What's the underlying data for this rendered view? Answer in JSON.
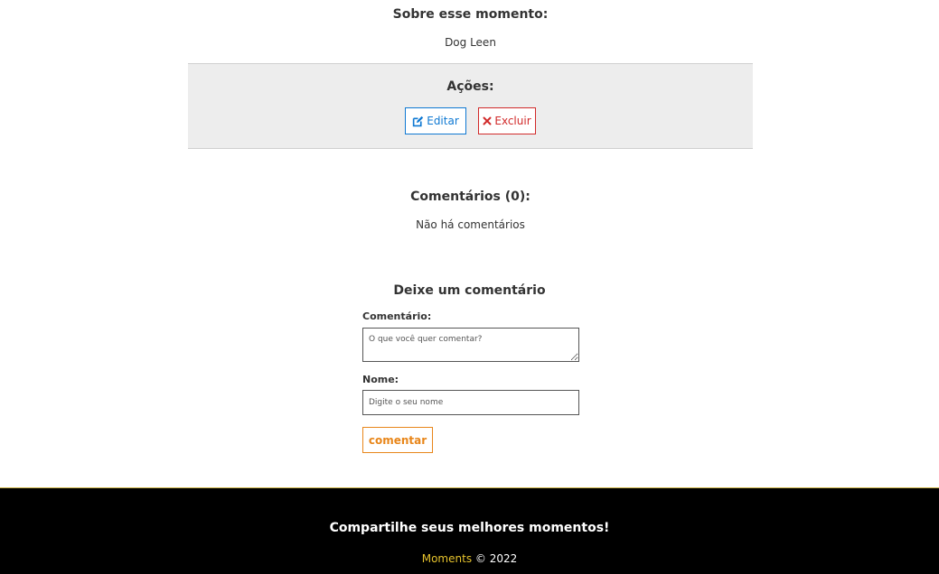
{
  "about": {
    "title": "Sobre esse momento:",
    "description": "Dog Leen"
  },
  "actions": {
    "title": "Ações:",
    "edit_label": "Editar",
    "edit_icon": "edit-icon",
    "delete_label": "Excluir",
    "delete_icon": "close-icon"
  },
  "comments": {
    "title": "Comentários (0):",
    "empty_text": "Não há comentários"
  },
  "form": {
    "title": "Deixe um comentário",
    "comment_label": "Comentário:",
    "comment_placeholder": "O que você quer comentar?",
    "comment_value": "",
    "name_label": "Nome:",
    "name_placeholder": "Digite o seu nome",
    "name_value": "",
    "submit_label": "comentar"
  },
  "footer": {
    "tagline": "Compartilhe seus melhores momentos!",
    "brand": "Moments",
    "copyright": "© 2022"
  },
  "colors": {
    "edit": "#0e78d2",
    "delete": "#d12a2a",
    "submit": "#e8861a",
    "brand": "#e6c32d",
    "footer_bg": "#000000",
    "actions_bg": "#ededed"
  }
}
